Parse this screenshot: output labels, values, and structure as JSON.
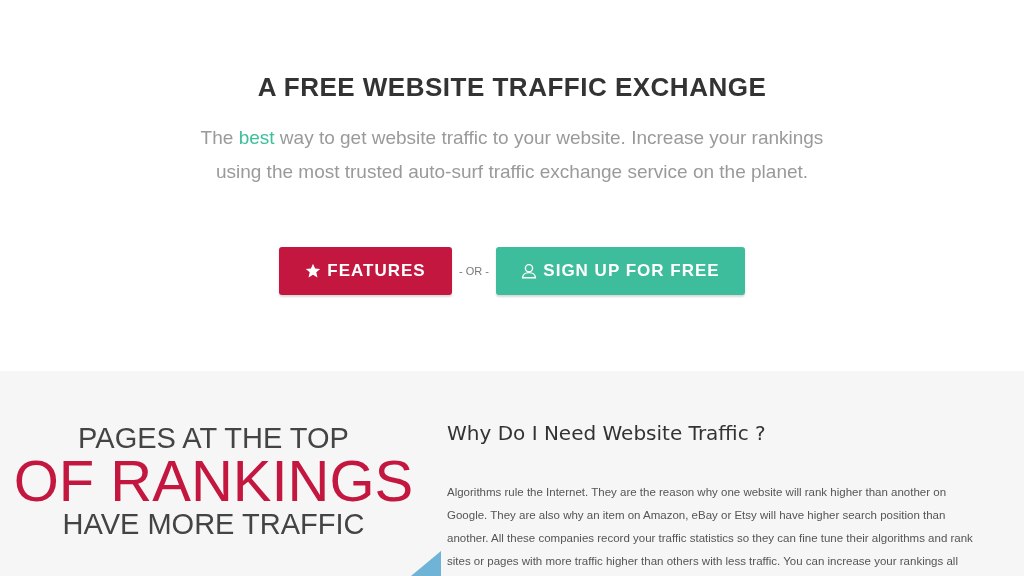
{
  "hero": {
    "title": "A FREE WEBSITE TRAFFIC EXCHANGE",
    "lead": {
      "before": "The ",
      "highlight": "best",
      "after": " way to get website traffic to your website. Increase your rankings using the most trusted auto-surf traffic exchange service on the planet."
    },
    "buttons": [
      {
        "kind": "star",
        "label": "FEATURES"
      },
      {
        "kind": "user",
        "label": "SIGN UP FOR FREE"
      }
    ],
    "separator": "- OR -"
  },
  "info": {
    "graphic": {
      "line_1": "PAGES AT THE TOP",
      "line_2": "OF RANKINGS",
      "line_3": "HAVE MORE TRAFFIC"
    },
    "heading": "Why Do I Need Website Traffic ?",
    "paragraph_lines": [
      "Algorithms rule the Internet. They are the reason why one website will rank higher than another on",
      "Google. They are also why an item on Amazon, eBay or Etsy will have higher search position than",
      "another. All these companies record your traffic statistics so they can fine tune their algorithms and rank",
      "sites or pages with more traffic higher than others with less traffic. You can increase your rankings all"
    ]
  }
}
